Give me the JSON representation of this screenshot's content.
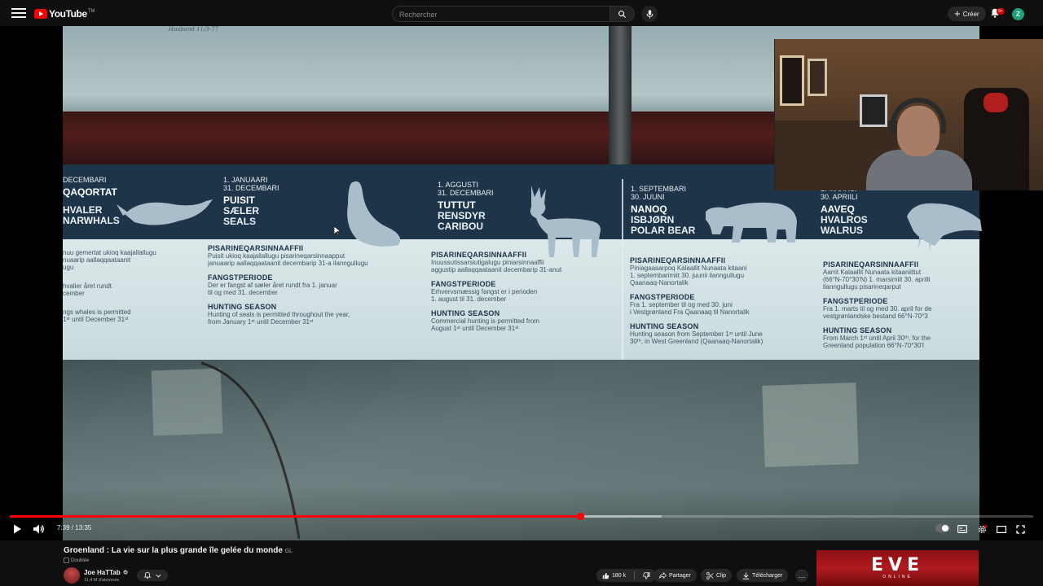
{
  "header": {
    "logo_text": "YouTube",
    "logo_suffix": "TM",
    "search_placeholder": "Rechercher",
    "create_label": "Créer",
    "notification_count": "9+",
    "avatar_letter": "Z"
  },
  "video": {
    "wall_scribble": "Husband 11/3-77",
    "columns": [
      {
        "dates": "DECEMBARI",
        "names": [
          "QAQORTAT",
          "HVALER",
          "NARWHALS"
        ]
      },
      {
        "dates": "1. JANUAARI\n31. DECEMBARI",
        "names": [
          "PUISIT",
          "SÆLER",
          "SEALS"
        ]
      },
      {
        "dates": "1. AGGUSTI\n31. DECEMBARI",
        "names": [
          "TUTTUT",
          "RENSDYR",
          "CARIBOU"
        ]
      },
      {
        "dates": "1. SEPTEMBARI\n30. JUUNI",
        "names": [
          "NANOQ",
          "ISBJØRN",
          "POLAR BEAR"
        ]
      },
      {
        "dates": "1. MAARSI\n30. APRIILI",
        "names": [
          "AAVEQ",
          "HVALROS",
          "WALRUS"
        ]
      }
    ],
    "info_blocks": [
      {
        "pis": "",
        "pis_text": "nuu gemertat ukioq kaajallallugu\nnuaarip aallaqqaataanit\nugu",
        "fang": "",
        "fang_text": "hvalier året rundt\ncember",
        "hunt": "",
        "hunt_text": "ngs whales is permitted\n1ˢᵗ until December 31ˢᵗ"
      },
      {
        "pis": "PISARINEQARSINNAAFFII",
        "pis_text": "Puisit ukioq kaajallallugu pisarineqarsinnaapput\njanuaarip aallaqqaataanit decembarip 31-a ilanngullugu",
        "fang": "FANGSTPERIODE",
        "fang_text": "Der er fangst af sæler året rundt fra 1. januar\ntil og med 31. december",
        "hunt": "HUNTING SEASON",
        "hunt_text": "Hunting of seals is permitted throughout the year,\nfrom January 1ˢᵗ until December 31ˢᵗ"
      },
      {
        "pis": "PISARINEQARSINNAAFFII",
        "pis_text": "Inuussutissarsiutigalugu piniarsinnaaffii\naggustip aallaqqaataanit decembarip 31-anut",
        "fang": "FANGSTPERIODE",
        "fang_text": "Erhvervsmæssig fangst er i perioden\n1. august til 31. december",
        "hunt": "HUNTING SEASON",
        "hunt_text": "Commercial hunting is permitted from\nAugust 1ˢᵗ until December 31ˢᵗ"
      },
      {
        "pis": "PISARINEQARSINNAAFFII",
        "pis_text": "Piniagaasarpoq Kalaallit Nunaata kitaani\n1. septembarimiit 30. juunii ilanngullugu\nQaanaaq-Nanortalik",
        "fang": "FANGSTPERIODE",
        "fang_text": "Fra 1. september til og med 30. juni\ni Vestgrønland Fra Qaanaaq til Nanortalik",
        "hunt": "HUNTING SEASON",
        "hunt_text": "Hunting season from September 1ˢᵗ until June\n30ᵗʰ, in West Greenland (Qaanaaq-Nanortalik)"
      },
      {
        "pis": "PISARINEQARSINNAAFFII",
        "pis_text": "Aarrit Kalaallit Nunaata kitaaniittut\n(66°N-70°30'N) 1. marsimiit 30. aprilli\nilanngullugu pisarineqarput",
        "fang": "FANGSTPERIODE",
        "fang_text": "Fra 1. marts til og med 30. april for de\nvestgrønlandske bestand 66°N-70°3",
        "hunt": "HUNTING SEASON",
        "hunt_text": "From March 1ˢᵗ until April 30ᵗʰ, for the\nGreenland population 66°N-70°30'I"
      }
    ],
    "progress": 0.557,
    "buffered": 0.637,
    "time_current": "7:39",
    "time_total": "13:35",
    "time_display": "7:39 / 13:35",
    "title": "Groenland : La vie sur la plus grande île gelée du monde",
    "title_badge": "GL",
    "dubbed_label": "Doublée"
  },
  "channel": {
    "name": "Joe HaTTab",
    "verified_icon": "verified-check-icon",
    "subscribers": "11,4 M d'abonnés"
  },
  "actions": {
    "likes": "180 k",
    "share": "Partager",
    "clip": "Clip",
    "download": "Télécharger",
    "more": "…"
  },
  "ad": {
    "brand": "EVE",
    "tagline": "ONLINE"
  },
  "colors": {
    "accent": "#ff0000",
    "poster_header": "#1d3449",
    "poster_body": "#dce8ea",
    "ad_red": "#b01b1f",
    "avatar_green": "#1ea27a"
  }
}
